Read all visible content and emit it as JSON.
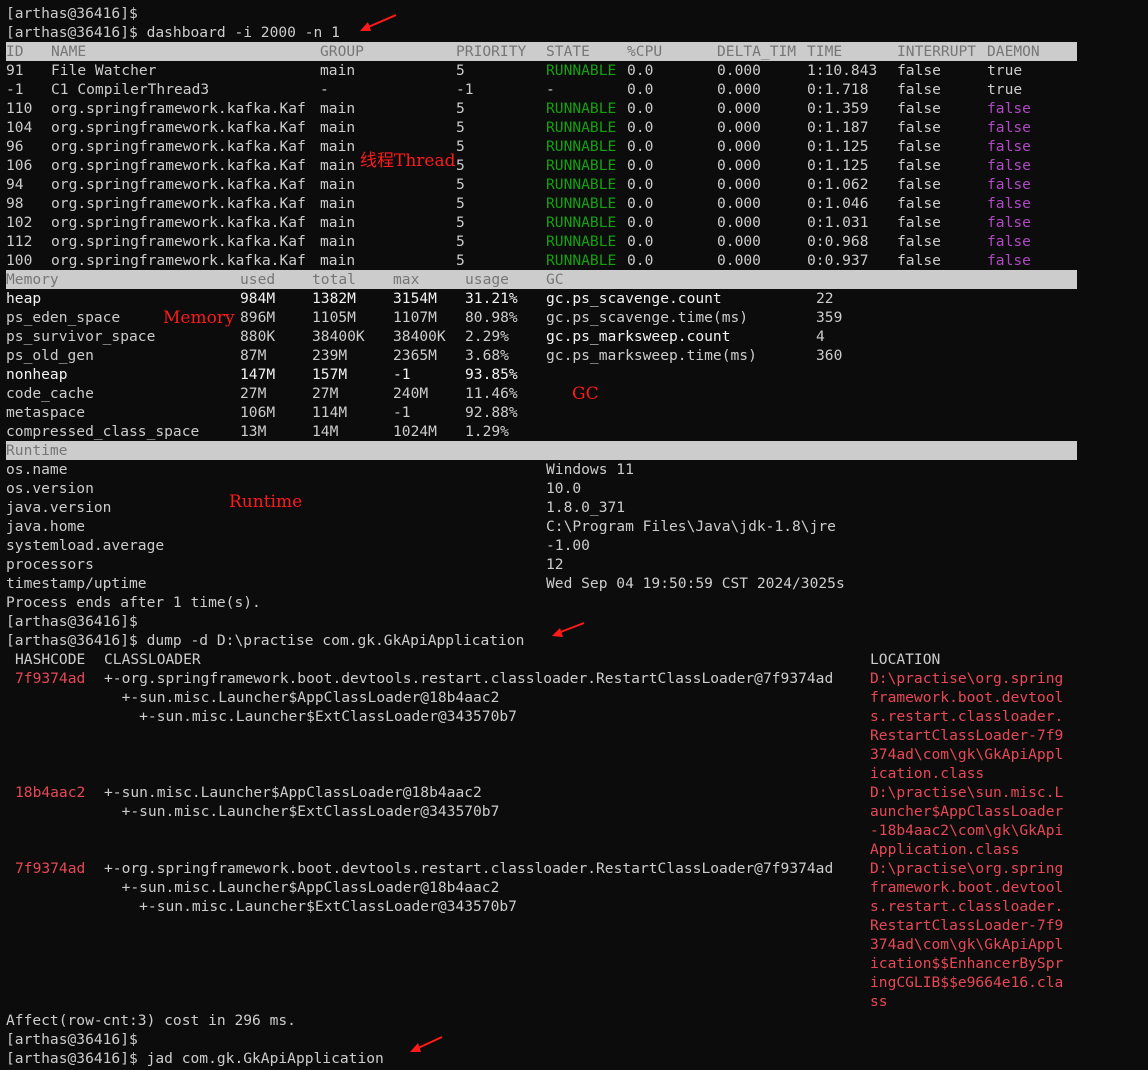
{
  "prompts": {
    "p0": "[arthas@36416]$",
    "dashboard_cmd": "[arthas@36416]$ dashboard -i 2000 -n 1",
    "p_after_dash": "[arthas@36416]$",
    "dump_cmd": "[arthas@36416]$ dump -d D:\\practise com.gk.GkApiApplication",
    "p_after_dump": "[arthas@36416]$",
    "jad_cmd": "[arthas@36416]$ jad com.gk.GkApiApplication"
  },
  "threads": {
    "headers": [
      "ID",
      "NAME",
      "GROUP",
      "PRIORITY",
      "STATE",
      "%CPU",
      "DELTA_TIM",
      "TIME",
      "INTERRUPT",
      "DAEMON"
    ],
    "rows": [
      [
        "91",
        "File Watcher",
        "main",
        "5",
        "RUNNABLE",
        "0.0",
        "0.000",
        "1:10.843",
        "false",
        "true"
      ],
      [
        "-1",
        "C1 CompilerThread3",
        "-",
        "-1",
        "-",
        "0.0",
        "0.000",
        "0:1.718",
        "false",
        "true"
      ],
      [
        "110",
        "org.springframework.kafka.Kaf",
        "main",
        "5",
        "RUNNABLE",
        "0.0",
        "0.000",
        "0:1.359",
        "false",
        "false"
      ],
      [
        "104",
        "org.springframework.kafka.Kaf",
        "main",
        "5",
        "RUNNABLE",
        "0.0",
        "0.000",
        "0:1.187",
        "false",
        "false"
      ],
      [
        "96",
        "org.springframework.kafka.Kaf",
        "main",
        "5",
        "RUNNABLE",
        "0.0",
        "0.000",
        "0:1.125",
        "false",
        "false"
      ],
      [
        "106",
        "org.springframework.kafka.Kaf",
        "main",
        "5",
        "RUNNABLE",
        "0.0",
        "0.000",
        "0:1.125",
        "false",
        "false"
      ],
      [
        "94",
        "org.springframework.kafka.Kaf",
        "main",
        "5",
        "RUNNABLE",
        "0.0",
        "0.000",
        "0:1.062",
        "false",
        "false"
      ],
      [
        "98",
        "org.springframework.kafka.Kaf",
        "main",
        "5",
        "RUNNABLE",
        "0.0",
        "0.000",
        "0:1.046",
        "false",
        "false"
      ],
      [
        "102",
        "org.springframework.kafka.Kaf",
        "main",
        "5",
        "RUNNABLE",
        "0.0",
        "0.000",
        "0:1.031",
        "false",
        "false"
      ],
      [
        "112",
        "org.springframework.kafka.Kaf",
        "main",
        "5",
        "RUNNABLE",
        "0.0",
        "0.000",
        "0:0.968",
        "false",
        "false"
      ],
      [
        "100",
        "org.springframework.kafka.Kaf",
        "main",
        "5",
        "RUNNABLE",
        "0.0",
        "0.000",
        "0:0.937",
        "false",
        "false"
      ]
    ]
  },
  "memory": {
    "headers": [
      "Memory",
      "used",
      "total",
      "max",
      "usage",
      "GC"
    ],
    "rows": [
      [
        "heap",
        "984M",
        "1382M",
        "3154M",
        "31.21%"
      ],
      [
        "ps_eden_space",
        "896M",
        "1105M",
        "1107M",
        "80.98%"
      ],
      [
        "ps_survivor_space",
        "880K",
        "38400K",
        "38400K",
        "2.29%"
      ],
      [
        "ps_old_gen",
        "87M",
        "239M",
        "2365M",
        "3.68%"
      ],
      [
        "nonheap",
        "147M",
        "157M",
        "-1",
        "93.85%"
      ],
      [
        "code_cache",
        "27M",
        "27M",
        "240M",
        "11.46%"
      ],
      [
        "metaspace",
        "106M",
        "114M",
        "-1",
        "92.88%"
      ],
      [
        "compressed_class_space",
        "13M",
        "14M",
        "1024M",
        "1.29%"
      ]
    ],
    "gc": [
      [
        "gc.ps_scavenge.count",
        "22"
      ],
      [
        "gc.ps_scavenge.time(ms)",
        "359"
      ],
      [
        "gc.ps_marksweep.count",
        "4"
      ],
      [
        "gc.ps_marksweep.time(ms)",
        "360"
      ]
    ]
  },
  "runtime": {
    "header": "Runtime",
    "rows": [
      [
        "os.name",
        "Windows 11"
      ],
      [
        "os.version",
        "10.0"
      ],
      [
        "java.version",
        "1.8.0_371"
      ],
      [
        "java.home",
        "C:\\Program Files\\Java\\jdk-1.8\\jre"
      ],
      [
        "systemload.average",
        "-1.00"
      ],
      [
        "processors",
        "12"
      ],
      [
        "timestamp/uptime",
        "Wed Sep 04 19:50:59 CST 2024/3025s"
      ]
    ],
    "process_end": "Process ends after 1 time(s)."
  },
  "dump": {
    "headers": [
      "HASHCODE",
      "CLASSLOADER",
      "LOCATION"
    ],
    "entries": [
      {
        "hash": "7f9374ad",
        "loaders": [
          "+-org.springframework.boot.devtools.restart.classloader.RestartClassLoader@7f9374ad",
          "  +-sun.misc.Launcher$AppClassLoader@18b4aac2",
          "    +-sun.misc.Launcher$ExtClassLoader@343570b7"
        ],
        "location": [
          "D:\\practise\\org.spring",
          "framework.boot.devtool",
          "s.restart.classloader.",
          "RestartClassLoader-7f9",
          "374ad\\com\\gk\\GkApiAppl",
          "ication.class"
        ]
      },
      {
        "hash": "18b4aac2",
        "loaders": [
          "+-sun.misc.Launcher$AppClassLoader@18b4aac2",
          "  +-sun.misc.Launcher$ExtClassLoader@343570b7"
        ],
        "location": [
          "D:\\practise\\sun.misc.L",
          "auncher$AppClassLoader",
          "-18b4aac2\\com\\gk\\GkApi",
          "Application.class"
        ]
      },
      {
        "hash": "7f9374ad",
        "loaders": [
          "+-org.springframework.boot.devtools.restart.classloader.RestartClassLoader@7f9374ad",
          "  +-sun.misc.Launcher$AppClassLoader@18b4aac2",
          "    +-sun.misc.Launcher$ExtClassLoader@343570b7"
        ],
        "location": [
          "D:\\practise\\org.spring",
          "framework.boot.devtool",
          "s.restart.classloader.",
          "RestartClassLoader-7f9",
          "374ad\\com\\gk\\GkApiAppl",
          "ication$$EnhancerBySpr",
          "ingCGLIB$$e9664e16.cla",
          "ss"
        ]
      }
    ],
    "affect": "Affect(row-cnt:3) cost in 296 ms."
  },
  "annotations": {
    "thread": "线程Thread",
    "memory": "Memory",
    "gc": "GC",
    "runtime": "Runtime"
  },
  "colors": {
    "background": "#0c0c0c",
    "text": "#cccccc",
    "header_bg": "#cccccc",
    "runnable": "#13a10e",
    "daemon_false": "#b148c6",
    "error_red": "#e74856",
    "annotation_red": "#ff1a1a"
  }
}
